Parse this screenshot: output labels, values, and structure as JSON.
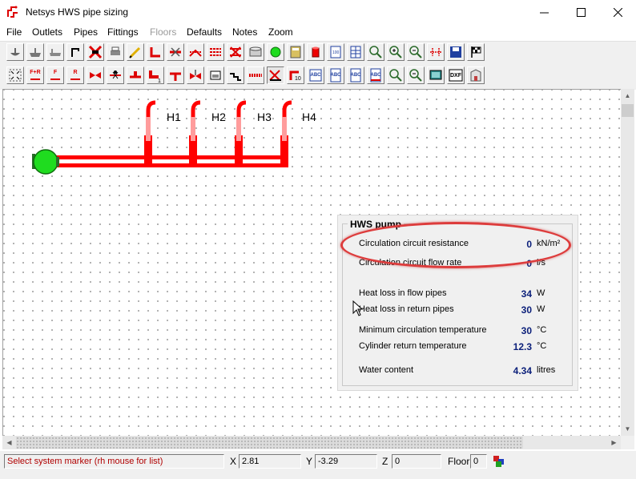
{
  "window": {
    "title": "Netsys HWS pipe sizing"
  },
  "menu": [
    "File",
    "Outlets",
    "Pipes",
    "Fittings",
    "Floors",
    "Defaults",
    "Notes",
    "Zoom"
  ],
  "menu_disabled": [
    "Floors"
  ],
  "toolbar_row1": [
    "basin-icon",
    "sink-icon",
    "bath-icon",
    "cylinder-outlet-icon",
    "delete-red-x-icon",
    "printer-icon",
    "pencil-draw-icon",
    "pipe-red-icon",
    "remove-fitting-icon",
    "fitting-set-icon",
    "multi-pipe-icon",
    "delete-pipes-icon",
    "store-icon",
    "pump-green-icon",
    "calculator-icon",
    "red-cylinder-icon",
    "report-page-icon",
    "grid-page-icon",
    "zoom-in-icon",
    "zoom-plus-icon",
    "zoom-out-icon",
    "network-icon",
    "save-icon",
    "finish-flag-icon"
  ],
  "toolbar_row2": [
    {
      "icon": "zoom-fit-icon",
      "text": ""
    },
    {
      "icon": "flow-return-icon",
      "text": "F+R"
    },
    {
      "icon": "flow-icon",
      "text": "F"
    },
    {
      "icon": "return-icon",
      "text": "R"
    },
    {
      "icon": "valve-icon",
      "text": ""
    },
    {
      "icon": "check-valve-icon",
      "text": ""
    },
    {
      "icon": "pump-fitting-icon",
      "text": ""
    },
    {
      "icon": "bend-1-icon",
      "text": ""
    },
    {
      "icon": "tee-icon",
      "text": ""
    },
    {
      "icon": "valve-2-icon",
      "text": ""
    },
    {
      "icon": "tank-icon",
      "text": ""
    },
    {
      "icon": "stair-icon",
      "text": ""
    },
    {
      "icon": "insulation-icon",
      "text": ""
    },
    {
      "icon": "angle-icon",
      "text": ""
    },
    {
      "icon": "pipe-length-icon",
      "text": ""
    },
    {
      "icon": "abc-report-icon",
      "text": "ABC"
    },
    {
      "icon": "abc-page-icon",
      "text": "ABC"
    },
    {
      "icon": "abc-doc-icon",
      "text": "ABC"
    },
    {
      "icon": "abc-red-icon",
      "text": "ABC"
    },
    {
      "icon": "zoom-window-icon",
      "text": ""
    },
    {
      "icon": "zoom-reset-icon",
      "text": ""
    },
    {
      "icon": "screen-icon",
      "text": ""
    },
    {
      "icon": "dxf-export-icon",
      "text": "DXF"
    },
    {
      "icon": "building-icon",
      "text": ""
    }
  ],
  "drawing": {
    "outlet_labels": [
      "H1",
      "H2",
      "H3",
      "H4"
    ],
    "pipe_color": "#ff0000",
    "riser_color": "#ff9c9c",
    "pump_color": "#1fdc1f"
  },
  "pump_panel": {
    "title": "HWS pump",
    "rows": [
      {
        "label": "Circulation circuit resistance",
        "value": "0",
        "unit": "kN/m²"
      },
      {
        "label": "Circulation circuit flow rate",
        "value": "0",
        "unit": "l/s"
      },
      {
        "label": "Heat loss in flow pipes",
        "value": "34",
        "unit": "W"
      },
      {
        "label": "Heat loss in return pipes",
        "value": "30",
        "unit": "W"
      },
      {
        "label": "Minimum circulation temperature",
        "value": "30",
        "unit": "°C"
      },
      {
        "label": "Cylinder return temperature",
        "value": "12.3",
        "unit": "°C"
      },
      {
        "label": "Water content",
        "value": "4.34",
        "unit": "litres"
      }
    ]
  },
  "status": {
    "message": "Select system marker (rh mouse for list)",
    "x_label": "X",
    "x": "2.81",
    "y_label": "Y",
    "y": "-3.29",
    "z_label": "Z",
    "z": "0",
    "floor_label": "Floor",
    "floor": "0"
  },
  "colors": {
    "value_text": "#0b1f7a",
    "status_message": "#b00000",
    "highlight": "#dd3c3c"
  }
}
